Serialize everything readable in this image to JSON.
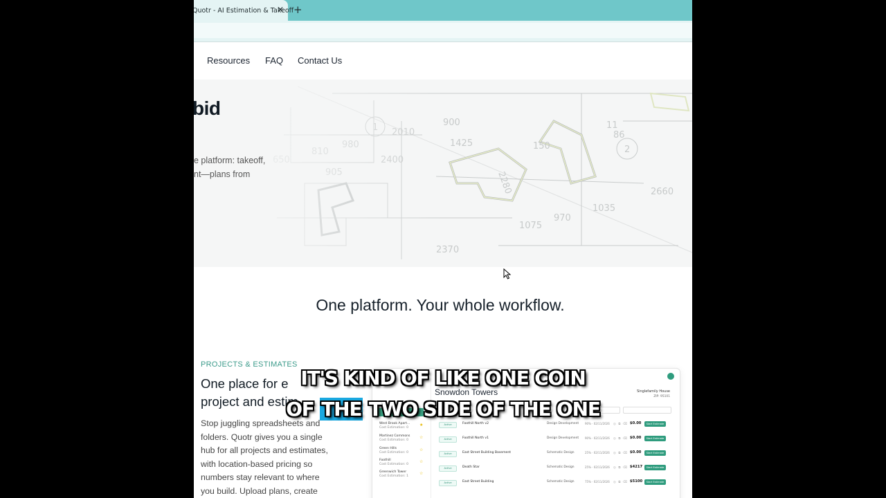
{
  "browser": {
    "tab_title": "Quotr - AI Estimation & Takeoff",
    "close_glyph": "✕",
    "new_tab_glyph": "+"
  },
  "nav": {
    "items": [
      "Resources",
      "FAQ",
      "Contact Us"
    ]
  },
  "hero": {
    "title_fragment": "bid",
    "subtitle_lines": [
      "e platform: takeoff,",
      "nt—plans from"
    ],
    "blueprint_numbers": [
      "2010",
      "900",
      "1425",
      "2400",
      "980",
      "810",
      "905",
      "2280",
      "2660",
      "1035",
      "970",
      "1075",
      "2370",
      "1",
      "2",
      "650",
      "150",
      "86",
      "11"
    ]
  },
  "section": {
    "title": "One platform. Your whole workflow."
  },
  "feature": {
    "eyebrow": "PROJECTS & ESTIMATES",
    "heading_lines": [
      "One place for e",
      "project and estim"
    ],
    "body_lines": [
      "Stop juggling spreadsheets and",
      "folders. Quotr gives you a single",
      "hub for all projects and estimates,",
      "with location-based pricing so",
      "numbers stay relevant to where",
      "you build. Upload plans, create"
    ]
  },
  "mockup": {
    "title": "Snowdon Towers",
    "meta_type": "Singlefamily House",
    "meta_zip": "ZIP: 95101",
    "sidebar": [
      {
        "name": "West Brook Apart...",
        "sub": "Cost Estimation: 0"
      },
      {
        "name": "Martinez Commons",
        "sub": "Cost Estimation: 0"
      },
      {
        "name": "Green Hills",
        "sub": "Cost Estimation: 0"
      },
      {
        "name": "Foothill",
        "sub": "Cost Estimation: 0"
      },
      {
        "name": "Greenwich Tower",
        "sub": "Cost Estimation: 1"
      }
    ],
    "rows": [
      {
        "tag": "Active",
        "name": "Foothill North v2",
        "phase": "Design Development",
        "pct": "90% · 02/11/2026",
        "amount": "$0.00",
        "action": "Start Estimate"
      },
      {
        "tag": "Active",
        "name": "Foothill North v1",
        "phase": "Design Development",
        "pct": "90% · 02/11/2026",
        "amount": "$0.00",
        "action": "Start Estimate"
      },
      {
        "tag": "Active",
        "name": "East Street Building Basement",
        "phase": "Schematic Design",
        "pct": "25% · 02/11/2026",
        "amount": "$0.00",
        "action": "Start Estimate"
      },
      {
        "tag": "Active",
        "name": "Death Star",
        "phase": "Schematic Design",
        "pct": "25% · 02/11/2026",
        "amount": "$4217",
        "action": "Start Estimate"
      },
      {
        "tag": "Active",
        "name": "East Street Building",
        "phase": "Schematic Design",
        "pct": "75% · 02/11/2026",
        "amount": "$5100",
        "action": "Start Estimate"
      }
    ]
  },
  "captions": {
    "line1": "IT'S KIND OF LIKE ONE COIN",
    "line2_pre": "OF ",
    "line2_highlight": "THE",
    "line2_post": " TWO SIDE OF THE ONE"
  },
  "colors": {
    "tab_bar": "#6fc7c9",
    "accent_green": "#2f9c7e",
    "caption_highlight": "#1aa8e0"
  }
}
